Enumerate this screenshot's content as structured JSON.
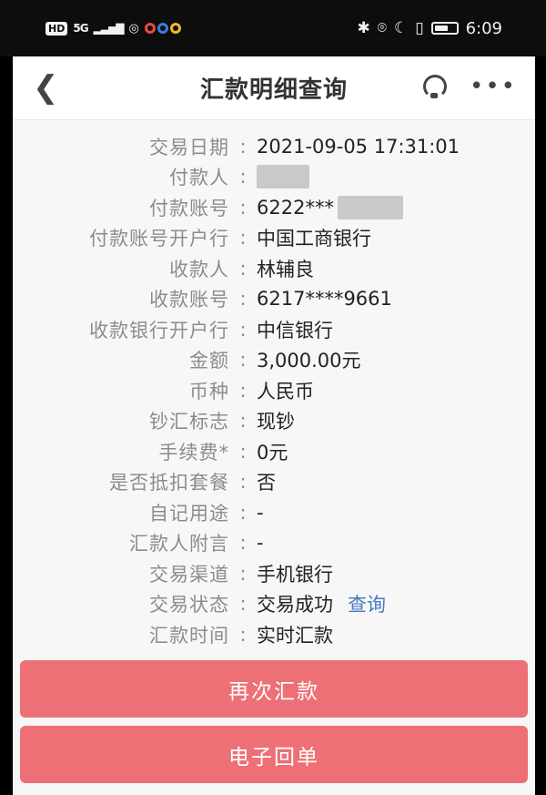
{
  "status_bar": {
    "hd_badge": "HD",
    "network": "5G",
    "time": "6:09",
    "dot_colors": [
      "#e94b3c",
      "#3b7ddd",
      "#f2b630"
    ]
  },
  "nav": {
    "title": "汇款明细查询"
  },
  "details": [
    {
      "label": "交易日期",
      "value": "2021-09-05 17:31:01"
    },
    {
      "label": "付款人",
      "value": "",
      "redacted": true
    },
    {
      "label": "付款账号",
      "value": "6222***",
      "redacted": true
    },
    {
      "label": "付款账号开户行",
      "value": "中国工商银行"
    },
    {
      "label": "收款人",
      "value": "林辅良"
    },
    {
      "label": "收款账号",
      "value": "6217****9661"
    },
    {
      "label": "收款银行开户行",
      "value": "中信银行"
    },
    {
      "label": "金额",
      "value": "3,000.00元"
    },
    {
      "label": "币种",
      "value": "人民币"
    },
    {
      "label": "钞汇标志",
      "value": "现钞"
    },
    {
      "label": "手续费*",
      "value": "0元"
    },
    {
      "label": "是否抵扣套餐",
      "value": "否"
    },
    {
      "label": "自记用途",
      "value": "-"
    },
    {
      "label": "汇款人附言",
      "value": "-"
    },
    {
      "label": "交易渠道",
      "value": "手机银行"
    },
    {
      "label": "交易状态",
      "value": "交易成功",
      "link": "查询"
    },
    {
      "label": "汇款时间",
      "value": "实时汇款"
    }
  ],
  "colon": ":",
  "buttons": {
    "again": "再次汇款",
    "receipt": "电子回单"
  },
  "colors": {
    "button": "#ec7076",
    "link": "#4a78c2"
  }
}
